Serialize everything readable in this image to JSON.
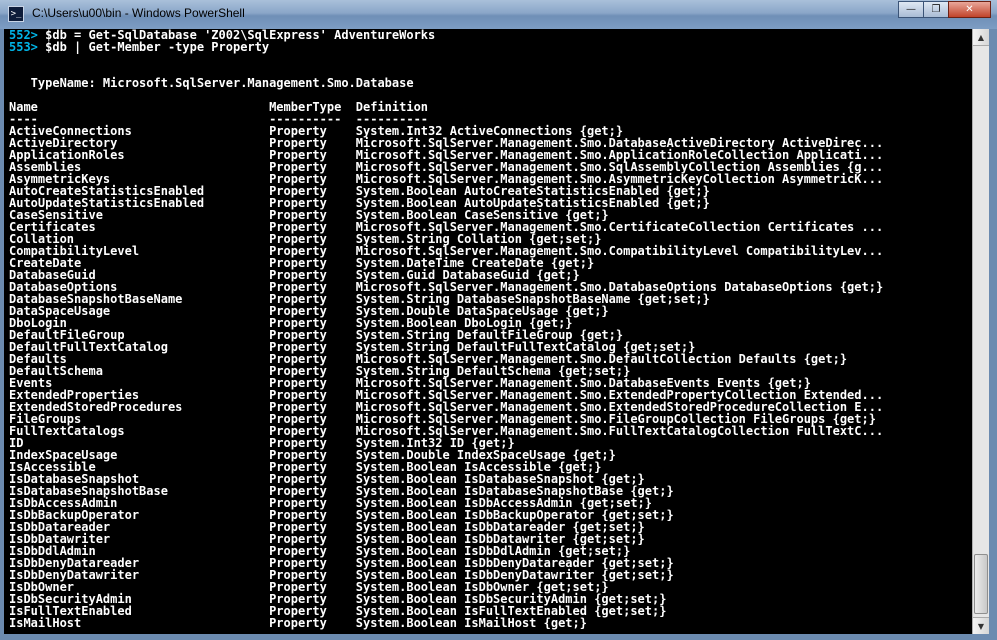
{
  "window": {
    "title": "C:\\Users\\u00\\bin - Windows PowerShell",
    "icon_label": ">_",
    "buttons": {
      "minimize": "—",
      "maximize": "❐",
      "close": "✕"
    }
  },
  "console": {
    "prompts": [
      {
        "num": "552>",
        "command": " $db = Get-SqlDatabase 'Z002\\SqlExpress' AdventureWorks"
      },
      {
        "num": "553>",
        "command": " $db | Get-Member -type Property"
      }
    ],
    "typename": "   TypeName: Microsoft.SqlServer.Management.Smo.Database",
    "header": "Name                                MemberType  Definition",
    "underline": "----                                ----------  ----------",
    "rows": [
      "ActiveConnections                   Property    System.Int32 ActiveConnections {get;}",
      "ActiveDirectory                     Property    Microsoft.SqlServer.Management.Smo.DatabaseActiveDirectory ActiveDirec...",
      "ApplicationRoles                    Property    Microsoft.SqlServer.Management.Smo.ApplicationRoleCollection Applicati...",
      "Assemblies                          Property    Microsoft.SqlServer.Management.Smo.SqlAssemblyCollection Assemblies {g...",
      "AsymmetricKeys                      Property    Microsoft.SqlServer.Management.Smo.AsymmetricKeyCollection AsymmetricK...",
      "AutoCreateStatisticsEnabled         Property    System.Boolean AutoCreateStatisticsEnabled {get;}",
      "AutoUpdateStatisticsEnabled         Property    System.Boolean AutoUpdateStatisticsEnabled {get;}",
      "CaseSensitive                       Property    System.Boolean CaseSensitive {get;}",
      "Certificates                        Property    Microsoft.SqlServer.Management.Smo.CertificateCollection Certificates ...",
      "Collation                           Property    System.String Collation {get;set;}",
      "CompatibilityLevel                  Property    Microsoft.SqlServer.Management.Smo.CompatibilityLevel CompatibilityLev...",
      "CreateDate                          Property    System.DateTime CreateDate {get;}",
      "DatabaseGuid                        Property    System.Guid DatabaseGuid {get;}",
      "DatabaseOptions                     Property    Microsoft.SqlServer.Management.Smo.DatabaseOptions DatabaseOptions {get;}",
      "DatabaseSnapshotBaseName            Property    System.String DatabaseSnapshotBaseName {get;set;}",
      "DataSpaceUsage                      Property    System.Double DataSpaceUsage {get;}",
      "DboLogin                            Property    System.Boolean DboLogin {get;}",
      "DefaultFileGroup                    Property    System.String DefaultFileGroup {get;}",
      "DefaultFullTextCatalog              Property    System.String DefaultFullTextCatalog {get;set;}",
      "Defaults                            Property    Microsoft.SqlServer.Management.Smo.DefaultCollection Defaults {get;}",
      "DefaultSchema                       Property    System.String DefaultSchema {get;set;}",
      "Events                              Property    Microsoft.SqlServer.Management.Smo.DatabaseEvents Events {get;}",
      "ExtendedProperties                  Property    Microsoft.SqlServer.Management.Smo.ExtendedPropertyCollection Extended...",
      "ExtendedStoredProcedures            Property    Microsoft.SqlServer.Management.Smo.ExtendedStoredProcedureCollection E...",
      "FileGroups                          Property    Microsoft.SqlServer.Management.Smo.FileGroupCollection FileGroups {get;}",
      "FullTextCatalogs                    Property    Microsoft.SqlServer.Management.Smo.FullTextCatalogCollection FullTextC...",
      "ID                                  Property    System.Int32 ID {get;}",
      "IndexSpaceUsage                     Property    System.Double IndexSpaceUsage {get;}",
      "IsAccessible                        Property    System.Boolean IsAccessible {get;}",
      "IsDatabaseSnapshot                  Property    System.Boolean IsDatabaseSnapshot {get;}",
      "IsDatabaseSnapshotBase              Property    System.Boolean IsDatabaseSnapshotBase {get;}",
      "IsDbAccessAdmin                     Property    System.Boolean IsDbAccessAdmin {get;set;}",
      "IsDbBackupOperator                  Property    System.Boolean IsDbBackupOperator {get;set;}",
      "IsDbDatareader                      Property    System.Boolean IsDbDatareader {get;set;}",
      "IsDbDatawriter                      Property    System.Boolean IsDbDatawriter {get;set;}",
      "IsDbDdlAdmin                        Property    System.Boolean IsDbDdlAdmin {get;set;}",
      "IsDbDenyDatareader                  Property    System.Boolean IsDbDenyDatareader {get;set;}",
      "IsDbDenyDatawriter                  Property    System.Boolean IsDbDenyDatawriter {get;set;}",
      "IsDbOwner                           Property    System.Boolean IsDbOwner {get;set;}",
      "IsDbSecurityAdmin                   Property    System.Boolean IsDbSecurityAdmin {get;set;}",
      "IsFullTextEnabled                   Property    System.Boolean IsFullTextEnabled {get;set;}",
      "IsMailHost                          Property    System.Boolean IsMailHost {get;}"
    ]
  },
  "scrollbar": {
    "up_arrow": "▲",
    "down_arrow": "▼"
  },
  "colors": {
    "prompt_number": "#00b4e6",
    "console_text": "#ffffff",
    "console_bg": "#000000"
  }
}
